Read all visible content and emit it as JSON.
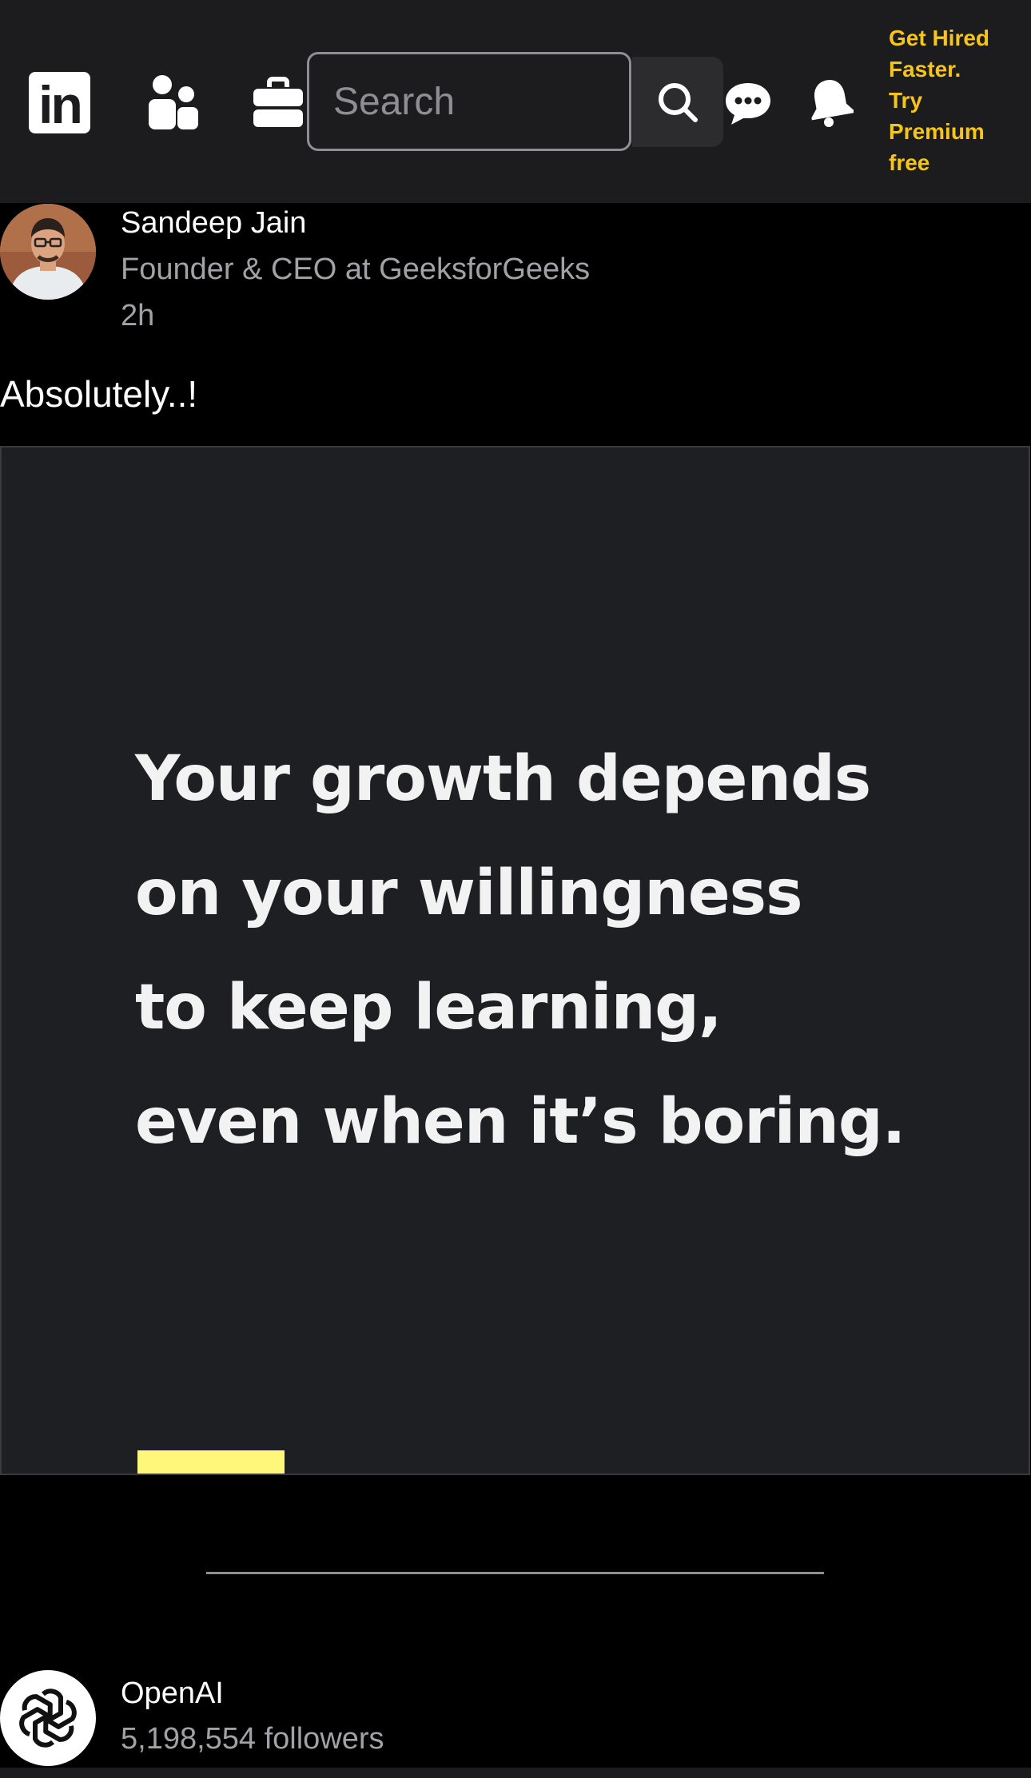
{
  "nav": {
    "logo_text": "in",
    "search_placeholder": "Search",
    "premium_lines": [
      "Get Hired",
      "Faster.",
      "Try",
      "Premium",
      "free"
    ],
    "premium_color": "#f5c518",
    "icons": [
      "linkedin-logo",
      "people-icon",
      "briefcase-icon",
      "search-icon",
      "messages-icon",
      "bell-icon"
    ]
  },
  "post": {
    "author_name": "Sandeep Jain",
    "author_headline": "Founder & CEO at GeeksforGeeks",
    "time": "2h",
    "text": "Absolutely..!",
    "image": {
      "quote_lines": [
        "Your growth depends",
        "on your willingness",
        "to keep learning,",
        "even when it’s boring."
      ],
      "background": "#1e1f23",
      "accent": "#fff77a"
    }
  },
  "next_post": {
    "author_name": "OpenAI",
    "followers": "5,198,554 followers"
  }
}
